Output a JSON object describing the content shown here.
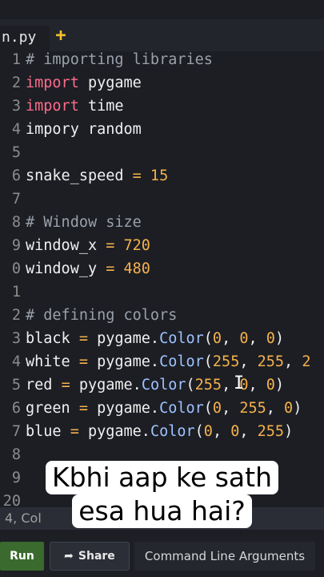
{
  "tabs": {
    "file_label": "n.py",
    "add_label": "+"
  },
  "editor": {
    "lines": [
      {
        "n": "1",
        "parts": [
          {
            "t": "# importing libraries",
            "c": "cm"
          }
        ]
      },
      {
        "n": "2",
        "parts": [
          {
            "t": "import",
            "c": "kw"
          },
          {
            "t": " pygame",
            "c": ""
          }
        ]
      },
      {
        "n": "3",
        "parts": [
          {
            "t": "import",
            "c": "kw"
          },
          {
            "t": " time",
            "c": ""
          }
        ]
      },
      {
        "n": "4",
        "parts": [
          {
            "t": "impory random",
            "c": ""
          }
        ]
      },
      {
        "n": "5",
        "parts": []
      },
      {
        "n": "6",
        "parts": [
          {
            "t": "snake_speed ",
            "c": ""
          },
          {
            "t": "=",
            "c": "op"
          },
          {
            "t": " 15",
            "c": "num"
          }
        ]
      },
      {
        "n": "7",
        "parts": []
      },
      {
        "n": "8",
        "parts": [
          {
            "t": "# Window size",
            "c": "cm"
          }
        ]
      },
      {
        "n": "9",
        "parts": [
          {
            "t": "window_x ",
            "c": ""
          },
          {
            "t": "=",
            "c": "op"
          },
          {
            "t": " 720",
            "c": "num"
          }
        ]
      },
      {
        "n": "0",
        "parts": [
          {
            "t": "window_y ",
            "c": ""
          },
          {
            "t": "=",
            "c": "op"
          },
          {
            "t": " 480",
            "c": "num"
          }
        ]
      },
      {
        "n": "1",
        "parts": []
      },
      {
        "n": "2",
        "parts": [
          {
            "t": "# defining colors",
            "c": "cm"
          }
        ]
      },
      {
        "n": "3",
        "parts": [
          {
            "t": "black ",
            "c": ""
          },
          {
            "t": "=",
            "c": "op"
          },
          {
            "t": " pygame.",
            "c": ""
          },
          {
            "t": "Color",
            "c": "fn"
          },
          {
            "t": "(",
            "c": ""
          },
          {
            "t": "0",
            "c": "num"
          },
          {
            "t": ", ",
            "c": ""
          },
          {
            "t": "0",
            "c": "num"
          },
          {
            "t": ", ",
            "c": ""
          },
          {
            "t": "0",
            "c": "num"
          },
          {
            "t": ")",
            "c": ""
          }
        ]
      },
      {
        "n": "4",
        "parts": [
          {
            "t": "white ",
            "c": ""
          },
          {
            "t": "=",
            "c": "op"
          },
          {
            "t": " pygame.",
            "c": ""
          },
          {
            "t": "Color",
            "c": "fn"
          },
          {
            "t": "(",
            "c": ""
          },
          {
            "t": "255",
            "c": "num"
          },
          {
            "t": ", ",
            "c": ""
          },
          {
            "t": "255",
            "c": "num"
          },
          {
            "t": ", ",
            "c": ""
          },
          {
            "t": "2",
            "c": "num"
          }
        ]
      },
      {
        "n": "5",
        "parts": [
          {
            "t": "red ",
            "c": ""
          },
          {
            "t": "=",
            "c": "op"
          },
          {
            "t": " pygame.",
            "c": ""
          },
          {
            "t": "Color",
            "c": "fn"
          },
          {
            "t": "(",
            "c": ""
          },
          {
            "t": "255",
            "c": "num"
          },
          {
            "t": ", ",
            "c": ""
          },
          {
            "t": "0",
            "c": "num"
          },
          {
            "t": ", ",
            "c": ""
          },
          {
            "t": "0",
            "c": "num"
          },
          {
            "t": ")",
            "c": ""
          }
        ]
      },
      {
        "n": "6",
        "parts": [
          {
            "t": "green ",
            "c": ""
          },
          {
            "t": "=",
            "c": "op"
          },
          {
            "t": " pygame.",
            "c": ""
          },
          {
            "t": "Color",
            "c": "fn"
          },
          {
            "t": "(",
            "c": ""
          },
          {
            "t": "0",
            "c": "num"
          },
          {
            "t": ", ",
            "c": ""
          },
          {
            "t": "255",
            "c": "num"
          },
          {
            "t": ", ",
            "c": ""
          },
          {
            "t": "0",
            "c": "num"
          },
          {
            "t": ")",
            "c": ""
          }
        ]
      },
      {
        "n": "7",
        "parts": [
          {
            "t": "blue ",
            "c": ""
          },
          {
            "t": "=",
            "c": "op"
          },
          {
            "t": " pygame.",
            "c": ""
          },
          {
            "t": "Color",
            "c": "fn"
          },
          {
            "t": "(",
            "c": ""
          },
          {
            "t": "0",
            "c": "num"
          },
          {
            "t": ", ",
            "c": ""
          },
          {
            "t": "0",
            "c": "num"
          },
          {
            "t": ", ",
            "c": ""
          },
          {
            "t": "255",
            "c": "num"
          },
          {
            "t": ")",
            "c": ""
          }
        ]
      },
      {
        "n": "8",
        "parts": []
      },
      {
        "n": "9",
        "parts": []
      },
      {
        "n": "20",
        "parts": []
      }
    ]
  },
  "status": {
    "position_text": "4, Col"
  },
  "toolbar": {
    "run_label": "Run",
    "share_label": "Share",
    "args_label": "Command Line Arguments"
  },
  "caption": {
    "line1": "Kbhi aap ke sath",
    "line2": "esa hua hai?"
  },
  "colors": {
    "keyword": "#ff6b8a",
    "number": "#f5b14c",
    "comment": "#9aa0aa",
    "function": "#9fc3ff",
    "run_button": "#3a6a2e",
    "background": "#1c1e24"
  }
}
